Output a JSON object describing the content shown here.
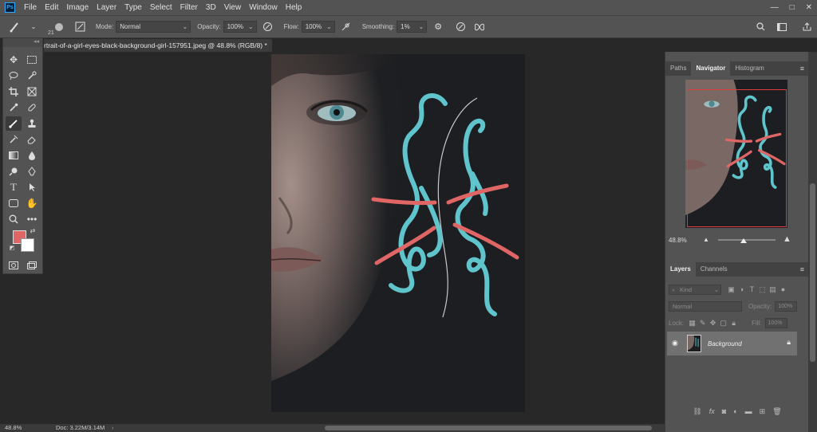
{
  "menubar": {
    "logo": "Ps",
    "items": [
      "File",
      "Edit",
      "Image",
      "Layer",
      "Type",
      "Select",
      "Filter",
      "3D",
      "View",
      "Window",
      "Help"
    ],
    "controls": [
      "—",
      "□",
      "✕"
    ]
  },
  "options": {
    "brush_size": "21",
    "mode_label": "Mode:",
    "mode_value": "Normal",
    "opacity_label": "Opacity:",
    "opacity_value": "100%",
    "flow_label": "Flow:",
    "flow_value": "100%",
    "smoothing_label": "Smoothing:",
    "smoothing_value": "1%"
  },
  "document": {
    "tab_title": "rtrait-of-a-girl-eyes-black-background-girl-157951.jpeg @ 48.8% (RGB/8) *"
  },
  "toolbar": {
    "fg_color": "#e06666",
    "bg_color": "#ffffff"
  },
  "panels": {
    "navigator_tabs": [
      "Paths",
      "Navigator",
      "Histogram"
    ],
    "zoom_value": "48.8%",
    "layers_tabs": [
      "Layers",
      "Channels"
    ],
    "kind_placeholder": "Kind",
    "blend_value": "Normal",
    "opacity_label": "Opacity:",
    "opacity_value": "100%",
    "lock_label": "Lock:",
    "fill_label": "Fill:",
    "fill_value": "100%",
    "layer_name": "Background"
  },
  "status": {
    "zoom": "48.8%",
    "doc": "Doc: 3.22M/3.14M",
    "arrow": "›"
  },
  "colors": {
    "cyan_stroke": "#5fc4cc",
    "red_stroke": "#e06666",
    "ui_bg": "#535353",
    "canvas_bg": "#282828"
  }
}
